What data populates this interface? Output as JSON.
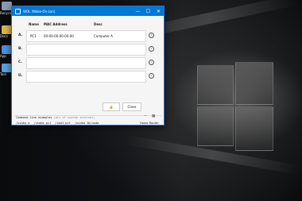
{
  "window": {
    "title": "WOL (Wake-On-Lan)",
    "minimize_glyph": "—",
    "maximize_glyph": "☐",
    "close_glyph": "✕"
  },
  "table": {
    "headers": [
      "Name",
      "MAC Address",
      "Desc"
    ],
    "rows": [
      {
        "letter": "A.",
        "name": "PC1",
        "mac": "00-00-00-00-00-00",
        "desc": "Computer A",
        "info": "i"
      },
      {
        "letter": "B.",
        "name": "",
        "mac": "",
        "desc": "",
        "info": "i"
      },
      {
        "letter": "C.",
        "name": "",
        "mac": "",
        "desc": "",
        "info": "i"
      },
      {
        "letter": "D.",
        "name": "",
        "mac": "",
        "desc": "",
        "info": "i"
      }
    ]
  },
  "buttons": {
    "lock_glyph": "🔒",
    "close_label": "Close"
  },
  "footer": {
    "title": "Command-line examples",
    "note": "(pls of system internal)",
    "examples": [
      "/usaka a",
      "/usaka pc1",
      "/cmd1 pc1",
      "/usaka 1b/usda"
    ],
    "router_label": "Home Router"
  },
  "desktop": {
    "icons": [
      {
        "label": "Recycle Bin",
        "color": "#8a9bb0"
      },
      {
        "label": "Docs",
        "color": "#d9b44a"
      },
      {
        "label": "App",
        "color": "#4a90d9"
      },
      {
        "label": "Tool",
        "color": "#5aa0e0"
      }
    ]
  },
  "colors": {
    "accent": "#0078d4"
  }
}
